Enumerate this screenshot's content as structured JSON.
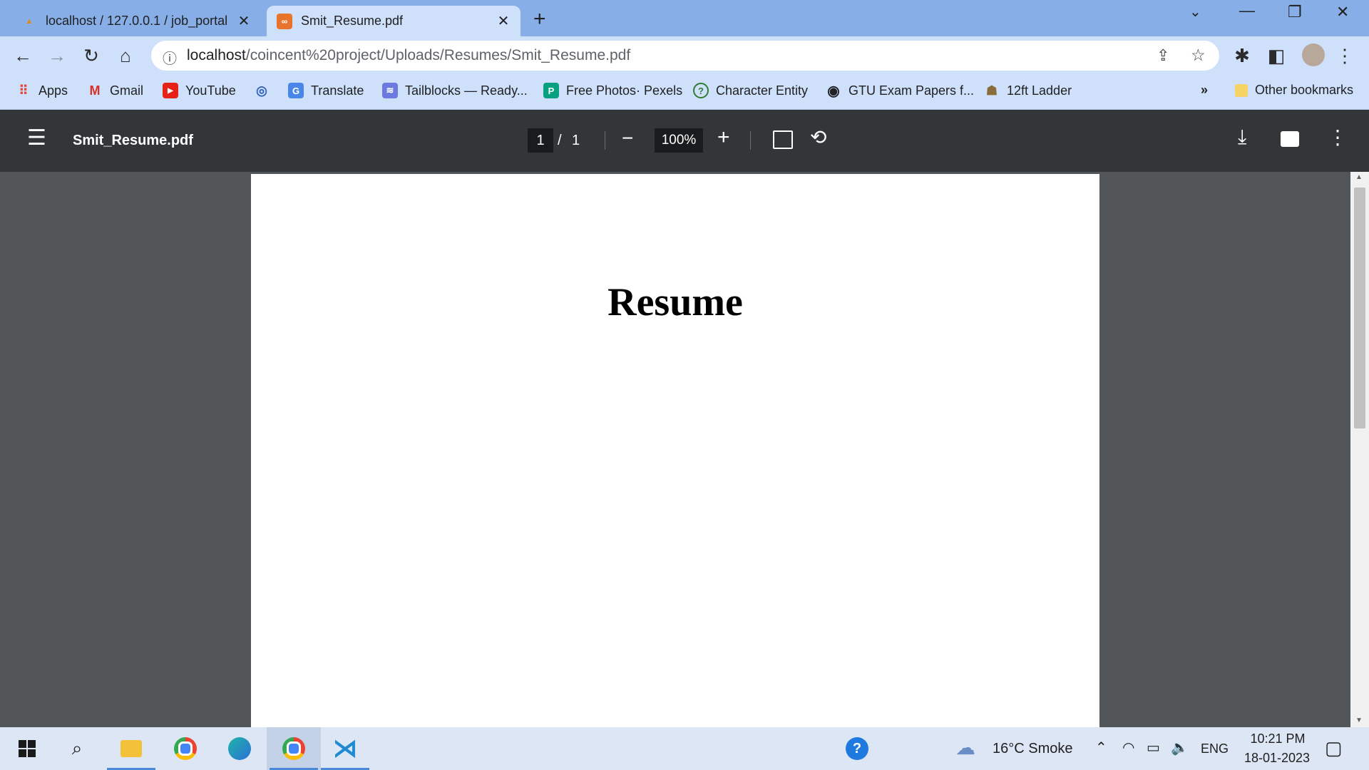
{
  "tabs": [
    {
      "title": "localhost / 127.0.0.1 / job_portal",
      "favicon": "phpmyadmin-icon"
    },
    {
      "title": "Smit_Resume.pdf",
      "favicon": "pdf-icon",
      "active": true
    }
  ],
  "address": {
    "host": "localhost",
    "path": "/coincent%20project/Uploads/Resumes/Smit_Resume.pdf"
  },
  "bookmarks": [
    {
      "label": "Apps"
    },
    {
      "label": "Gmail"
    },
    {
      "label": "YouTube"
    },
    {
      "label": ""
    },
    {
      "label": "Translate"
    },
    {
      "label": "Tailblocks — Ready..."
    },
    {
      "label": "Free Photos· Pexels"
    },
    {
      "label": "Character Entity"
    },
    {
      "label": "GTU Exam Papers f..."
    },
    {
      "label": "12ft Ladder"
    }
  ],
  "bookmarks_overflow": "»",
  "other_bookmarks": "Other bookmarks",
  "pdf": {
    "filename": "Smit_Resume.pdf",
    "page_current": "1",
    "page_sep": "/",
    "page_total": "1",
    "zoom": "100%",
    "document_title": "Resume"
  },
  "taskbar": {
    "weather": "16°C  Smoke",
    "lang": "ENG",
    "time": "10:21 PM",
    "date": "18-01-2023"
  },
  "colors": {
    "tabstrip": "#87aee6",
    "toolbar": "#cfe0fb",
    "pdfbar": "#323639",
    "viewer_bg": "#525659"
  }
}
